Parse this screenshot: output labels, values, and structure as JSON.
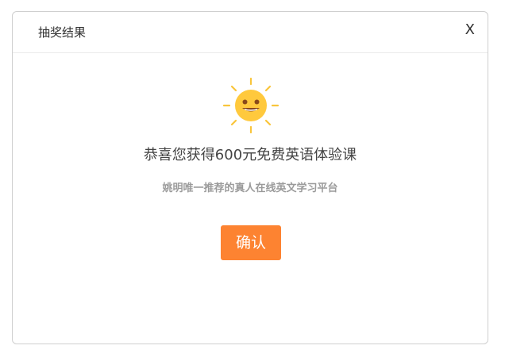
{
  "dialog": {
    "title": "抽奖结果",
    "close_label": "X",
    "message": "恭喜您获得600元免费英语体验课",
    "subtitle": "姚明唯一推荐的真人在线英文学习平台",
    "confirm_label": "确认"
  },
  "colors": {
    "accent": "#fd8331",
    "sun": "#ffc93d",
    "sun_rays": "#f9c53c",
    "border": "#cfcfcf"
  },
  "icons": {
    "sun": "smiling-sun-icon"
  }
}
